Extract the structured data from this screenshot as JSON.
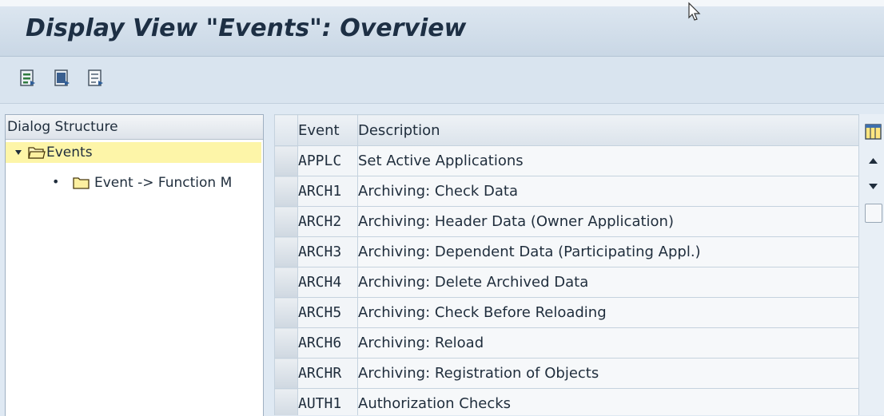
{
  "window": {
    "title": "Display View \"Events\": Overview"
  },
  "toolbar": {
    "buttons": [
      {
        "icon": "display-sap-object-icon"
      },
      {
        "icon": "select-all-icon"
      },
      {
        "icon": "deselect-all-icon"
      }
    ]
  },
  "dialog_structure": {
    "header": "Dialog Structure",
    "items": [
      {
        "label": "Events",
        "expanded": true,
        "selected": true,
        "icon": "open-folder-icon"
      },
      {
        "label": "Event -> Function M",
        "selected": false,
        "icon": "folder-icon"
      }
    ]
  },
  "table": {
    "columns": [
      "Event",
      "Description"
    ],
    "rows": [
      {
        "event": "APPLC",
        "description": "Set Active Applications"
      },
      {
        "event": "ARCH1",
        "description": "Archiving: Check Data"
      },
      {
        "event": "ARCH2",
        "description": "Archiving: Header Data (Owner Application)"
      },
      {
        "event": "ARCH3",
        "description": "Archiving: Dependent Data (Participating Appl.)"
      },
      {
        "event": "ARCH4",
        "description": "Archiving: Delete Archived Data"
      },
      {
        "event": "ARCH5",
        "description": "Archiving: Check Before Reloading"
      },
      {
        "event": "ARCH6",
        "description": "Archiving: Reload"
      },
      {
        "event": "ARCHR",
        "description": "Archiving: Registration of Objects"
      },
      {
        "event": "AUTH1",
        "description": "Authorization Checks"
      }
    ]
  },
  "colors": {
    "title_bar": "#c9d7e5",
    "selected_tree_item": "#fdf5a8",
    "background": "#dfe9f3"
  }
}
